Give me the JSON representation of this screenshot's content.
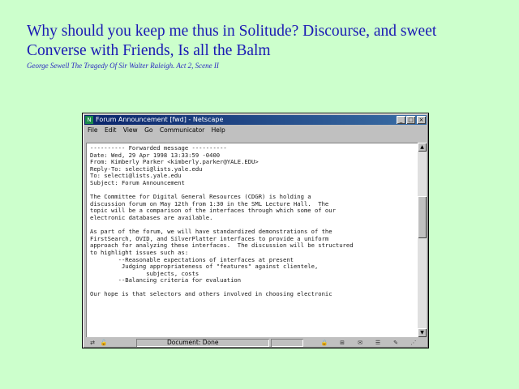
{
  "quote": {
    "line1": "Why should you keep me thus in Solitude?  Discourse, and sweet",
    "line2": "Converse with Friends,  Is all the Balm"
  },
  "citation": "George Sewell  The Tragedy Of Sir Walter Raleigh. Act 2, Scene II",
  "window": {
    "title": "Forum Announcement [fwd] - Netscape",
    "controls": [
      "_",
      "□",
      "×"
    ],
    "menu": [
      "File",
      "Edit",
      "View",
      "Go",
      "Communicator",
      "Help"
    ],
    "body_lines": [
      "---------- Forwarded message ----------",
      "Date: Wed, 29 Apr 1998 13:33:59 -0400",
      "From: Kimberly Parker <kimberly.parker@YALE.EDU>",
      "Reply-To: selecti@lists.yale.edu",
      "To: selecti@lists.yale.edu",
      "Subject: Forum Announcement",
      "",
      "The Committee for Digital General Resources (CDGR) is holding a",
      "discussion forum on May 12th from 1:30 in the SML Lecture Hall.  The",
      "topic will be a comparison of the interfaces through which some of our",
      "electronic databases are available.",
      "",
      "As part of the forum, we will have standardized demonstrations of the",
      "FirstSearch, OVID, and SilverPlatter interfaces to provide a uniform",
      "approach for analyzing these interfaces.  The discussion will be structured",
      "to highlight issues such as:",
      "        --Reasonable expectations of interfaces at present",
      "         Judging appropriateness of \"features\" against clientele,",
      "                subjects, costs",
      "        --Balancing criteria for evaluation",
      "",
      "Our hope is that selectors and others involved in choosing electronic"
    ],
    "status": "Document: Done",
    "status_icons": [
      "lock-icon",
      "component-icon",
      "mail-icon",
      "news-icon",
      "composer-icon"
    ],
    "colors": {
      "titlebar_start": "#0a246a",
      "titlebar_end": "#3a6ea5",
      "chrome": "#c0c0c0"
    }
  },
  "page": {
    "background": "#ccffcc",
    "quote_color": "#1a1ab4"
  }
}
